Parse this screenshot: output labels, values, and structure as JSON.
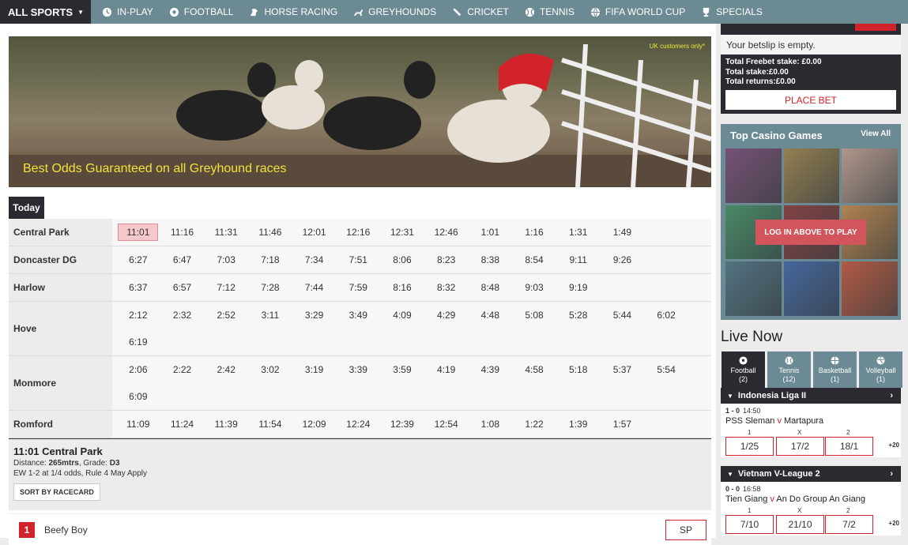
{
  "nav": {
    "all_sports": "ALL SPORTS",
    "items": [
      {
        "label": "IN-PLAY",
        "icon": "clock-icon"
      },
      {
        "label": "FOOTBALL",
        "icon": "football-icon"
      },
      {
        "label": "HORSE RACING",
        "icon": "horse-icon"
      },
      {
        "label": "GREYHOUNDS",
        "icon": "greyhound-icon"
      },
      {
        "label": "CRICKET",
        "icon": "cricket-bat-icon"
      },
      {
        "label": "TENNIS",
        "icon": "tennis-ball-icon"
      },
      {
        "label": "FIFA WORLD CUP",
        "icon": "globe-icon"
      },
      {
        "label": "SPECIALS",
        "icon": "trophy-icon"
      }
    ]
  },
  "banner": {
    "uk_note": "UK customers only*",
    "promo": "Best Odds Guaranteed on all Greyhound races"
  },
  "schedule": {
    "tab": "Today",
    "venues": [
      {
        "name": "Central Park",
        "times": [
          "11:01",
          "11:16",
          "11:31",
          "11:46",
          "12:01",
          "12:16",
          "12:31",
          "12:46",
          "1:01",
          "1:16",
          "1:31",
          "1:49"
        ]
      },
      {
        "name": "Doncaster DG",
        "times": [
          "6:27",
          "6:47",
          "7:03",
          "7:18",
          "7:34",
          "7:51",
          "8:06",
          "8:23",
          "8:38",
          "8:54",
          "9:11",
          "9:26"
        ]
      },
      {
        "name": "Harlow",
        "times": [
          "6:37",
          "6:57",
          "7:12",
          "7:28",
          "7:44",
          "7:59",
          "8:16",
          "8:32",
          "8:48",
          "9:03",
          "9:19"
        ]
      },
      {
        "name": "Hove",
        "times": [
          "2:12",
          "2:32",
          "2:52",
          "3:11",
          "3:29",
          "3:49",
          "4:09",
          "4:29",
          "4:48",
          "5:08",
          "5:28",
          "5:44",
          "6:02",
          "6:19"
        ]
      },
      {
        "name": "Monmore",
        "times": [
          "2:06",
          "2:22",
          "2:42",
          "3:02",
          "3:19",
          "3:39",
          "3:59",
          "4:19",
          "4:39",
          "4:58",
          "5:18",
          "5:37",
          "5:54",
          "6:09"
        ]
      },
      {
        "name": "Romford",
        "times": [
          "11:09",
          "11:24",
          "11:39",
          "11:54",
          "12:09",
          "12:24",
          "12:39",
          "12:54",
          "1:08",
          "1:22",
          "1:39",
          "1:57"
        ]
      }
    ],
    "selected": "11:01"
  },
  "race_detail": {
    "title": "11:01 Central Park",
    "distance_label": "Distance: ",
    "distance": "265mtrs",
    "grade_label": ", Grade: ",
    "grade": "D3",
    "terms": "EW 1-2 at 1/4 odds, Rule 4 May Apply",
    "sort_button": "SORT BY RACECARD"
  },
  "runner": {
    "number": "1",
    "name": "Beefy Boy",
    "price": "SP"
  },
  "betslip": {
    "empty": "Your betslip is empty.",
    "freebet": "Total Freebet stake: £0.00",
    "stake": "Total stake:£0.00",
    "returns": "Total returns:£0.00",
    "place_bet": "PLACE BET"
  },
  "casino": {
    "title": "Top Casino Games",
    "view_all": "View All",
    "login": "LOG IN ABOVE TO PLAY",
    "tile_colors": [
      "#7a3f6b",
      "#a07a3c",
      "#c79a88",
      "#3f8a5a",
      "#8a2a2a",
      "#c9803a",
      "#4a6a7a",
      "#3a5aa0",
      "#c94a2a"
    ]
  },
  "live": {
    "title": "Live Now",
    "tabs": [
      {
        "label": "Football",
        "count": "(2)",
        "icon": "football-icon"
      },
      {
        "label": "Tennis",
        "count": "(12)",
        "icon": "tennis-ball-icon"
      },
      {
        "label": "Basketball",
        "count": "(1)",
        "icon": "basketball-icon"
      },
      {
        "label": "Volleyball",
        "count": "(1)",
        "icon": "volleyball-icon"
      }
    ],
    "matches": [
      {
        "league": "Indonesia Liga II",
        "score": "1 - 0",
        "time": "14:50",
        "home": "PSS Sleman",
        "away": "Martapura",
        "odds": [
          "1/25",
          "17/2",
          "18/1"
        ],
        "more": "+20"
      },
      {
        "league": "Vietnam V-League 2",
        "score": "0 - 0",
        "time": "16:58",
        "home": "Tien Giang",
        "away": "An Do Group An Giang",
        "odds": [
          "7/10",
          "21/10",
          "7/2"
        ],
        "more": "+20"
      }
    ],
    "labels": [
      "1",
      "X",
      "2"
    ],
    "versus": "v"
  }
}
